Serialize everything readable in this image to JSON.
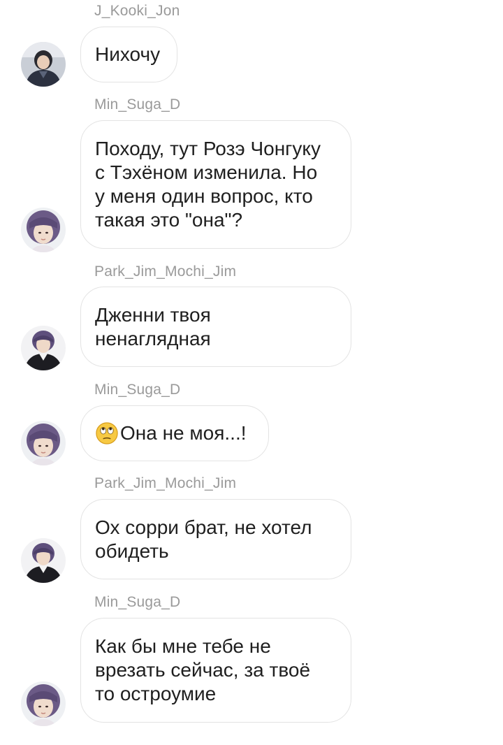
{
  "messages": [
    {
      "sender": "J_Kooki_Jon",
      "text": "Нихочу",
      "avatar": "avatar-dark-hair"
    },
    {
      "sender": "Min_Suga_D",
      "text": "Походу, тут Розэ Чонгуку\nс Тэхёном изменила. Но\nу меня один вопрос, кто\nтакая это \"она\"?",
      "avatar": "avatar-purple-hair"
    },
    {
      "sender": "Park_Jim_Mochi_Jim",
      "text": "Дженни твоя\nненаглядная",
      "avatar": "avatar-purple-hair-black-jacket"
    },
    {
      "sender": "Min_Suga_D",
      "emoji": "face-with-rolling-eyes-emoji",
      "text": "Она не моя...!",
      "avatar": "avatar-purple-hair"
    },
    {
      "sender": "Park_Jim_Mochi_Jim",
      "text": "Ох сорри брат, не хотел\nобидеть",
      "avatar": "avatar-purple-hair-black-jacket"
    },
    {
      "sender": "Min_Suga_D",
      "text": "Как бы мне тебе не\nврезать сейчас, за твоё\nто остроумие",
      "avatar": "avatar-purple-hair"
    }
  ]
}
